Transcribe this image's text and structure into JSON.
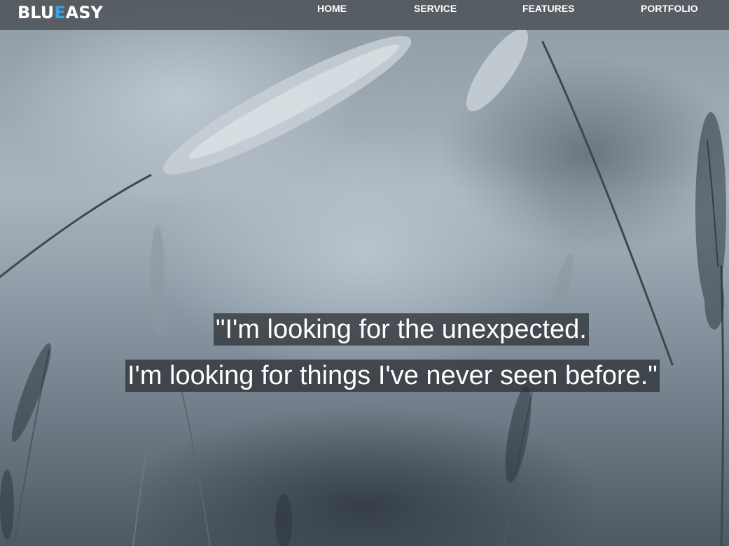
{
  "brand": {
    "logo_part1": "BLU",
    "logo_accent": "E",
    "logo_part2": "ASY",
    "accent_color": "#3aa3e3"
  },
  "nav": {
    "items": [
      {
        "label": "HOME"
      },
      {
        "label": "SERVICE"
      },
      {
        "label": "FEATURES"
      },
      {
        "label": "PORTFOLIO"
      }
    ]
  },
  "hero": {
    "quote_line1": "\"I'm looking for the unexpected.",
    "quote_line2": "I'm looking for things I've never seen before.\""
  }
}
